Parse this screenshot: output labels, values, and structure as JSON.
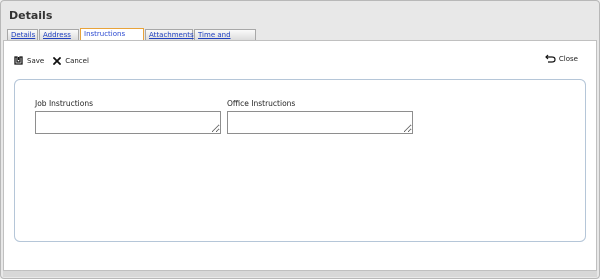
{
  "window": {
    "title": "Details"
  },
  "tabs": [
    {
      "label": "Details",
      "active": false
    },
    {
      "label": "Address",
      "active": false
    },
    {
      "label": "Instructions",
      "active": true
    },
    {
      "label": "Attachments",
      "active": false
    },
    {
      "label": "Time and Expense",
      "active": false
    }
  ],
  "toolbar": {
    "save_label": "Save",
    "cancel_label": "Cancel",
    "close_label": "Close"
  },
  "form": {
    "job_instructions": {
      "label": "Job Instructions",
      "value": ""
    },
    "office_instructions": {
      "label": "Office Instructions",
      "value": ""
    }
  },
  "colors": {
    "active_tab_border": "#e8a33a",
    "tab_link": "#2040c0",
    "form_border": "#b5c6d8"
  }
}
